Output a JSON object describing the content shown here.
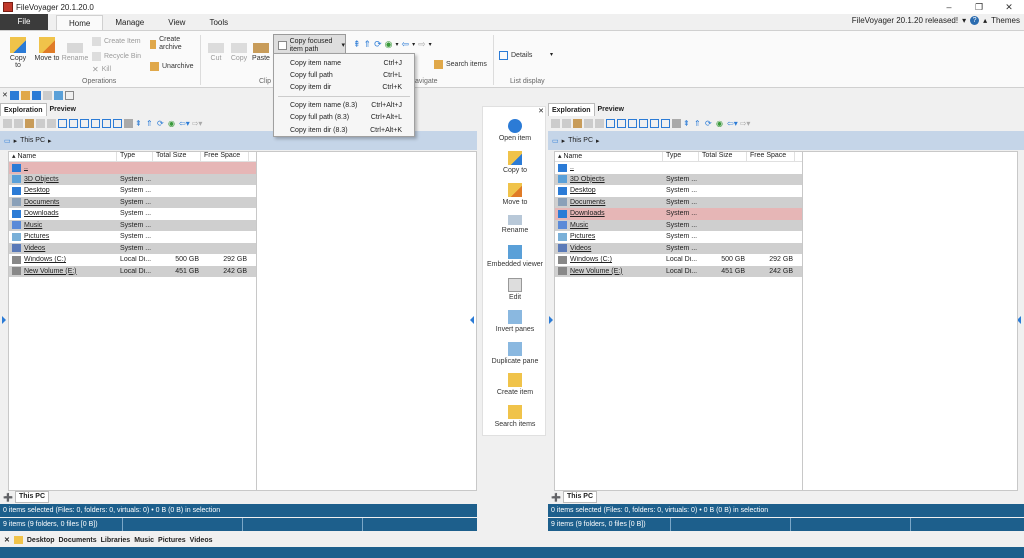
{
  "window": {
    "title": "FileVoyager 20.1.20.0",
    "controls": [
      "–",
      "❐",
      "✕"
    ]
  },
  "ribbon_tabs": [
    "File",
    "Home",
    "Manage",
    "View",
    "Tools"
  ],
  "ribbon_right": {
    "release_text": "FileVoyager 20.1.20 released!",
    "themes_label": "Themes"
  },
  "ribbon": {
    "copy_to": "Copy to",
    "move_to": "Move to",
    "rename": "Rename",
    "create_item": "Create Item",
    "recycle_bin": "Recycle Bin",
    "kill": "Kill",
    "create_archive": "Create archive",
    "unarchive": "Unarchive",
    "cut": "Cut",
    "copy": "Copy",
    "paste": "Paste",
    "copy_focused": "Copy focused item path",
    "merger_partial": "ger",
    "search_items": "Search items",
    "details": "Details",
    "groups": {
      "operations": "Operations",
      "clipboard_partial": "Clip",
      "navigate_partial": "avigate",
      "list_display": "List display"
    }
  },
  "copy_menu": [
    {
      "label": "Copy item name",
      "shortcut": "Ctrl+J"
    },
    {
      "label": "Copy full path",
      "shortcut": "Ctrl+L"
    },
    {
      "label": "Copy item dir",
      "shortcut": "Ctrl+K"
    },
    {
      "label": "Copy item name (8.3)",
      "shortcut": "Ctrl+Alt+J"
    },
    {
      "label": "Copy full path (8.3)",
      "shortcut": "Ctrl+Alt+L"
    },
    {
      "label": "Copy item dir (8.3)",
      "shortcut": "Ctrl+Alt+K"
    }
  ],
  "pane_tabs": [
    "Exploration",
    "Preview"
  ],
  "breadcrumb": "This PC",
  "columns": [
    "Name",
    "Type",
    "Total Size",
    "Free Space"
  ],
  "left_rows": [
    {
      "name": "..",
      "type": "",
      "total": "",
      "free": "",
      "icon": "up-arrow-icon",
      "style": "red"
    },
    {
      "name": "3D Objects",
      "type": "System ...",
      "total": "",
      "free": "",
      "icon": "objects-folder-icon",
      "style": "grey"
    },
    {
      "name": "Desktop",
      "type": "System ...",
      "total": "",
      "free": "",
      "icon": "desktop-folder-icon",
      "style": ""
    },
    {
      "name": "Documents",
      "type": "System ...",
      "total": "",
      "free": "",
      "icon": "documents-folder-icon",
      "style": "grey"
    },
    {
      "name": "Downloads",
      "type": "System ...",
      "total": "",
      "free": "",
      "icon": "downloads-folder-icon",
      "style": ""
    },
    {
      "name": "Music",
      "type": "System ...",
      "total": "",
      "free": "",
      "icon": "music-folder-icon",
      "style": "grey"
    },
    {
      "name": "Pictures",
      "type": "System ...",
      "total": "",
      "free": "",
      "icon": "pictures-folder-icon",
      "style": ""
    },
    {
      "name": "Videos",
      "type": "System ...",
      "total": "",
      "free": "",
      "icon": "videos-folder-icon",
      "style": "grey"
    },
    {
      "name": "Windows (C:)",
      "type": "Local Di...",
      "total": "500 GB",
      "free": "292 GB",
      "icon": "drive-icon",
      "style": ""
    },
    {
      "name": "New Volume (E:)",
      "type": "Local Di...",
      "total": "451 GB",
      "free": "242 GB",
      "icon": "drive-icon",
      "style": "grey"
    }
  ],
  "right_rows": [
    {
      "name": "..",
      "type": "",
      "total": "",
      "free": "",
      "icon": "up-arrow-icon",
      "style": ""
    },
    {
      "name": "3D Objects",
      "type": "System ...",
      "total": "",
      "free": "",
      "icon": "objects-folder-icon",
      "style": "grey"
    },
    {
      "name": "Desktop",
      "type": "System ...",
      "total": "",
      "free": "",
      "icon": "desktop-folder-icon",
      "style": ""
    },
    {
      "name": "Documents",
      "type": "System ...",
      "total": "",
      "free": "",
      "icon": "documents-folder-icon",
      "style": "grey"
    },
    {
      "name": "Downloads",
      "type": "System ...",
      "total": "",
      "free": "",
      "icon": "downloads-folder-icon",
      "style": "red"
    },
    {
      "name": "Music",
      "type": "System ...",
      "total": "",
      "free": "",
      "icon": "music-folder-icon",
      "style": "grey"
    },
    {
      "name": "Pictures",
      "type": "System ...",
      "total": "",
      "free": "",
      "icon": "pictures-folder-icon",
      "style": ""
    },
    {
      "name": "Videos",
      "type": "System ...",
      "total": "",
      "free": "",
      "icon": "videos-folder-icon",
      "style": "grey"
    },
    {
      "name": "Windows (C:)",
      "type": "Local Di...",
      "total": "500 GB",
      "free": "292 GB",
      "icon": "drive-icon",
      "style": ""
    },
    {
      "name": "New Volume (E:)",
      "type": "Local Di...",
      "total": "451 GB",
      "free": "242 GB",
      "icon": "drive-icon",
      "style": "grey"
    }
  ],
  "pane_bottom_tab": "This PC",
  "status": {
    "selection": "0 items selected (Files: 0, folders: 0, virtuals: 0) • 0 B (0 B) in selection",
    "summary": "9 items (9 folders, 0 files [0 B])"
  },
  "middle_actions": [
    "Open item",
    "Copy to",
    "Move to",
    "Rename",
    "Embedded viewer",
    "Edit",
    "Invert panes",
    "Duplicate pane",
    "Create item",
    "Search items"
  ],
  "bookmarks": [
    "Desktop",
    "Documents",
    "Libraries",
    "Music",
    "Pictures",
    "Videos"
  ],
  "colors": {
    "status_bar": "#1d5f8c",
    "breadcrumb_bg": "#c5d5e8",
    "selected_red": "#e6b6b6",
    "alt_row_grey": "#cfcfcf"
  }
}
